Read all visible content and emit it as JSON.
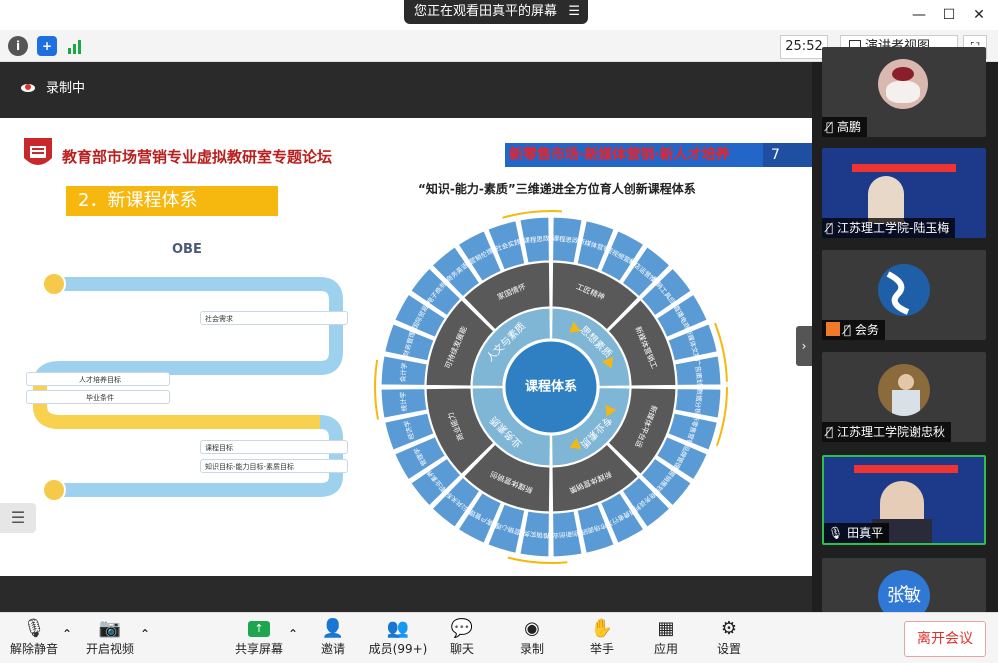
{
  "window": {
    "share_banner": "您正在观看田真平的屏幕",
    "menu_glyph": "☰"
  },
  "toolbar": {
    "timer": "25:52",
    "view_label": "演讲者视图"
  },
  "stage": {
    "recording_label": "录制中"
  },
  "slide": {
    "forum_title": "教育部市场营销专业虚拟教研室专题论坛",
    "tag_line": "新零售市场·新媒体营销·新人才培养",
    "page_number": "7",
    "section_title": "2．新课程体系",
    "subtitle": "“知识-能力-素质”三维递进全方位育人创新课程体系",
    "obe_label": "OBE",
    "flow_items": [
      "社会需求",
      "人才培养目标",
      "毕业条件",
      "课程目标",
      "知识目标-能力目标-素质目标"
    ],
    "wheel": {
      "center": "课程体系",
      "inner": [
        "思想素质",
        "专业素质",
        "业务素质",
        "人文与素质"
      ],
      "middle": [
        "工匠精神",
        "新媒体营销工具应用能力",
        "新媒体平台运营分析能力",
        "新媒体营销策划能力",
        "新媒体营销创意能力",
        "商业能力",
        "可持续发展能力",
        "家国情怀"
      ],
      "outer": [
        "课程思政",
        "新媒体营销",
        "短视频营销",
        "网店运营推广",
        "营销工具应用",
        "直播电商",
        "新媒体文案",
        "广告策划",
        "数据分析",
        "新零售营销",
        "品牌管理",
        "营销策划",
        "商务谈判",
        "消费者行为",
        "市场调研",
        "创新创业",
        "推销实务",
        "营销心理",
        "客户管理",
        "公共关系",
        "职业素养",
        "管理学",
        "经济学",
        "统计学",
        "会计学",
        "财务管理",
        "国际贸易",
        "电子商务",
        "商务英语",
        "营销伦理",
        "社会实践",
        "课程思政"
      ]
    }
  },
  "participants": [
    {
      "name": "高鹏"
    },
    {
      "name": "江苏理工学院-陆玉梅"
    },
    {
      "name": "会务"
    },
    {
      "name": "江苏理工学院谢忠秋"
    },
    {
      "name": "田真平"
    },
    {
      "name": "张敏"
    }
  ],
  "bottom_bar": {
    "unmute": "解除静音",
    "start_video": "开启视频",
    "share_screen": "共享屏幕",
    "invite": "邀请",
    "members": "成员(99+)",
    "chat": "聊天",
    "record": "录制",
    "raise_hand": "举手",
    "apps": "应用",
    "settings": "设置",
    "leave": "离开会议"
  },
  "colors": {
    "accent_red": "#e0302a",
    "slide_blue": "#2266c8",
    "ring_blue": "#5b9bd5",
    "ring_gray": "#595959",
    "inner_teal": "#7fb6d6",
    "section_yellow": "#f6b80f"
  }
}
